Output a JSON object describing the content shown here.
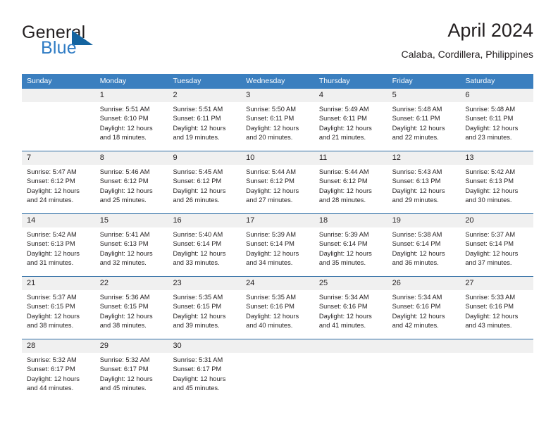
{
  "brand": {
    "name_part1": "General",
    "name_part2": "Blue",
    "logo_icon": "triangle-flag-icon",
    "color_blue": "#2e7bc4",
    "color_dark": "#231f20"
  },
  "header": {
    "title": "April 2024",
    "subtitle": "Calaba, Cordillera, Philippines"
  },
  "theme": {
    "header_blue": "#3b7fbf",
    "week_rule": "#2e6da4",
    "date_band": "#f0f0f0"
  },
  "weekdays": [
    "Sunday",
    "Monday",
    "Tuesday",
    "Wednesday",
    "Thursday",
    "Friday",
    "Saturday"
  ],
  "weeks": [
    {
      "days": [
        {
          "num": "",
          "sunrise": "",
          "sunset": "",
          "daylight": "",
          "empty": true
        },
        {
          "num": "1",
          "sunrise": "Sunrise: 5:51 AM",
          "sunset": "Sunset: 6:10 PM",
          "daylight": "Daylight: 12 hours and 18 minutes."
        },
        {
          "num": "2",
          "sunrise": "Sunrise: 5:51 AM",
          "sunset": "Sunset: 6:11 PM",
          "daylight": "Daylight: 12 hours and 19 minutes."
        },
        {
          "num": "3",
          "sunrise": "Sunrise: 5:50 AM",
          "sunset": "Sunset: 6:11 PM",
          "daylight": "Daylight: 12 hours and 20 minutes."
        },
        {
          "num": "4",
          "sunrise": "Sunrise: 5:49 AM",
          "sunset": "Sunset: 6:11 PM",
          "daylight": "Daylight: 12 hours and 21 minutes."
        },
        {
          "num": "5",
          "sunrise": "Sunrise: 5:48 AM",
          "sunset": "Sunset: 6:11 PM",
          "daylight": "Daylight: 12 hours and 22 minutes."
        },
        {
          "num": "6",
          "sunrise": "Sunrise: 5:48 AM",
          "sunset": "Sunset: 6:11 PM",
          "daylight": "Daylight: 12 hours and 23 minutes."
        }
      ]
    },
    {
      "days": [
        {
          "num": "7",
          "sunrise": "Sunrise: 5:47 AM",
          "sunset": "Sunset: 6:12 PM",
          "daylight": "Daylight: 12 hours and 24 minutes."
        },
        {
          "num": "8",
          "sunrise": "Sunrise: 5:46 AM",
          "sunset": "Sunset: 6:12 PM",
          "daylight": "Daylight: 12 hours and 25 minutes."
        },
        {
          "num": "9",
          "sunrise": "Sunrise: 5:45 AM",
          "sunset": "Sunset: 6:12 PM",
          "daylight": "Daylight: 12 hours and 26 minutes."
        },
        {
          "num": "10",
          "sunrise": "Sunrise: 5:44 AM",
          "sunset": "Sunset: 6:12 PM",
          "daylight": "Daylight: 12 hours and 27 minutes."
        },
        {
          "num": "11",
          "sunrise": "Sunrise: 5:44 AM",
          "sunset": "Sunset: 6:12 PM",
          "daylight": "Daylight: 12 hours and 28 minutes."
        },
        {
          "num": "12",
          "sunrise": "Sunrise: 5:43 AM",
          "sunset": "Sunset: 6:13 PM",
          "daylight": "Daylight: 12 hours and 29 minutes."
        },
        {
          "num": "13",
          "sunrise": "Sunrise: 5:42 AM",
          "sunset": "Sunset: 6:13 PM",
          "daylight": "Daylight: 12 hours and 30 minutes."
        }
      ]
    },
    {
      "days": [
        {
          "num": "14",
          "sunrise": "Sunrise: 5:42 AM",
          "sunset": "Sunset: 6:13 PM",
          "daylight": "Daylight: 12 hours and 31 minutes."
        },
        {
          "num": "15",
          "sunrise": "Sunrise: 5:41 AM",
          "sunset": "Sunset: 6:13 PM",
          "daylight": "Daylight: 12 hours and 32 minutes."
        },
        {
          "num": "16",
          "sunrise": "Sunrise: 5:40 AM",
          "sunset": "Sunset: 6:14 PM",
          "daylight": "Daylight: 12 hours and 33 minutes."
        },
        {
          "num": "17",
          "sunrise": "Sunrise: 5:39 AM",
          "sunset": "Sunset: 6:14 PM",
          "daylight": "Daylight: 12 hours and 34 minutes."
        },
        {
          "num": "18",
          "sunrise": "Sunrise: 5:39 AM",
          "sunset": "Sunset: 6:14 PM",
          "daylight": "Daylight: 12 hours and 35 minutes."
        },
        {
          "num": "19",
          "sunrise": "Sunrise: 5:38 AM",
          "sunset": "Sunset: 6:14 PM",
          "daylight": "Daylight: 12 hours and 36 minutes."
        },
        {
          "num": "20",
          "sunrise": "Sunrise: 5:37 AM",
          "sunset": "Sunset: 6:14 PM",
          "daylight": "Daylight: 12 hours and 37 minutes."
        }
      ]
    },
    {
      "days": [
        {
          "num": "21",
          "sunrise": "Sunrise: 5:37 AM",
          "sunset": "Sunset: 6:15 PM",
          "daylight": "Daylight: 12 hours and 38 minutes."
        },
        {
          "num": "22",
          "sunrise": "Sunrise: 5:36 AM",
          "sunset": "Sunset: 6:15 PM",
          "daylight": "Daylight: 12 hours and 38 minutes."
        },
        {
          "num": "23",
          "sunrise": "Sunrise: 5:35 AM",
          "sunset": "Sunset: 6:15 PM",
          "daylight": "Daylight: 12 hours and 39 minutes."
        },
        {
          "num": "24",
          "sunrise": "Sunrise: 5:35 AM",
          "sunset": "Sunset: 6:16 PM",
          "daylight": "Daylight: 12 hours and 40 minutes."
        },
        {
          "num": "25",
          "sunrise": "Sunrise: 5:34 AM",
          "sunset": "Sunset: 6:16 PM",
          "daylight": "Daylight: 12 hours and 41 minutes."
        },
        {
          "num": "26",
          "sunrise": "Sunrise: 5:34 AM",
          "sunset": "Sunset: 6:16 PM",
          "daylight": "Daylight: 12 hours and 42 minutes."
        },
        {
          "num": "27",
          "sunrise": "Sunrise: 5:33 AM",
          "sunset": "Sunset: 6:16 PM",
          "daylight": "Daylight: 12 hours and 43 minutes."
        }
      ]
    },
    {
      "days": [
        {
          "num": "28",
          "sunrise": "Sunrise: 5:32 AM",
          "sunset": "Sunset: 6:17 PM",
          "daylight": "Daylight: 12 hours and 44 minutes."
        },
        {
          "num": "29",
          "sunrise": "Sunrise: 5:32 AM",
          "sunset": "Sunset: 6:17 PM",
          "daylight": "Daylight: 12 hours and 45 minutes."
        },
        {
          "num": "30",
          "sunrise": "Sunrise: 5:31 AM",
          "sunset": "Sunset: 6:17 PM",
          "daylight": "Daylight: 12 hours and 45 minutes."
        },
        {
          "num": "",
          "sunrise": "",
          "sunset": "",
          "daylight": "",
          "empty": true
        },
        {
          "num": "",
          "sunrise": "",
          "sunset": "",
          "daylight": "",
          "empty": true
        },
        {
          "num": "",
          "sunrise": "",
          "sunset": "",
          "daylight": "",
          "empty": true
        },
        {
          "num": "",
          "sunrise": "",
          "sunset": "",
          "daylight": "",
          "empty": true
        }
      ]
    }
  ]
}
